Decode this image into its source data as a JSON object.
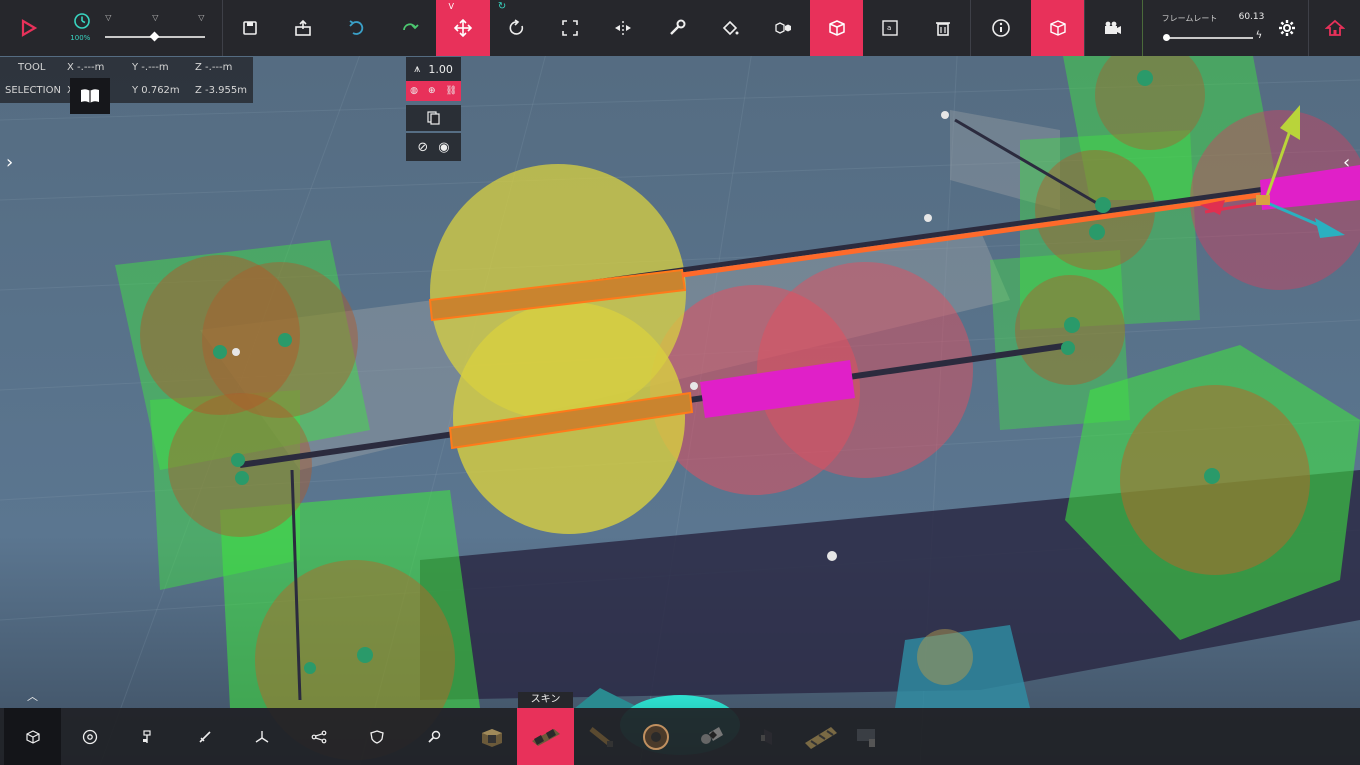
{
  "colors": {
    "accent": "#e8315a",
    "toolbar": "#26272c",
    "sim_teal": "#38d4c0"
  },
  "sim": {
    "time_scale": "100%"
  },
  "toolbar": {
    "left_icons": [
      "play-icon",
      "clock-icon"
    ],
    "right_icons": [
      "save-icon",
      "load-icon",
      "undo-icon",
      "redo-icon",
      "move-tool-icon",
      "rotate-icon",
      "scale-icon",
      "flip-icon",
      "wrench-icon",
      "paint-icon",
      "skin-toggle-icon",
      "block-mode-icon",
      "text-icon",
      "delete-icon",
      "info-icon",
      "cube-icon",
      "camera-icon",
      "settings-icon",
      "home-icon"
    ]
  },
  "framerate": {
    "label": "フレームレート",
    "value": "60.13"
  },
  "coords": {
    "tool_label": "TOOL",
    "selection_label": "SELECTION",
    "tool_x": "X -.---m",
    "tool_y": "Y -.---m",
    "tool_z": "Z -.---m",
    "sel_x": "X",
    "sel_y": "Y 0.762m",
    "sel_z": "Z -3.955m"
  },
  "move_panel": {
    "snap_value": "1.00"
  },
  "bottom": {
    "categories": [
      "block-category-icon",
      "wheel-category-icon",
      "mechanical-category-icon",
      "weapon-category-icon",
      "flight-category-icon",
      "automation-category-icon",
      "armor-category-icon",
      "utility-category-icon"
    ],
    "blocks": [
      "wooden-block",
      "skin-block",
      "brace-block",
      "round-block",
      "pin-block",
      "spike-block",
      "long-block",
      "camera-block"
    ],
    "tooltip": "スキン"
  }
}
